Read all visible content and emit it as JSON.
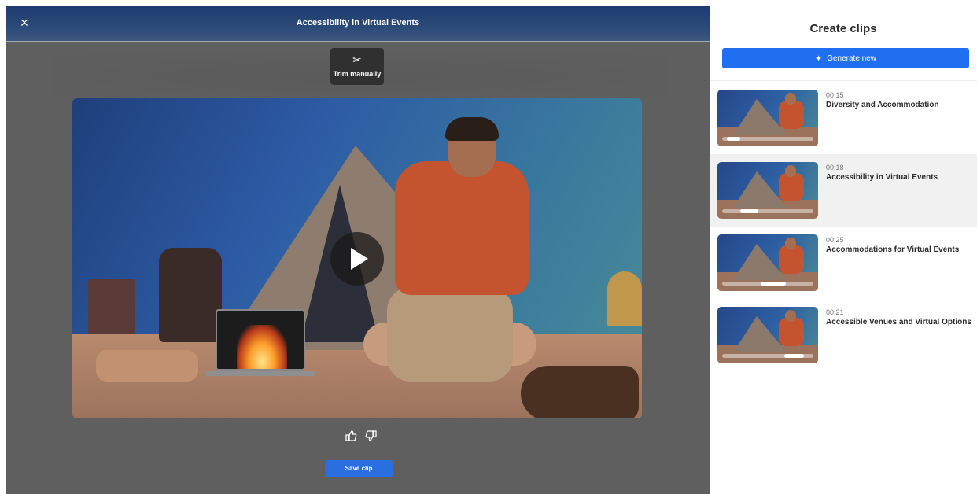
{
  "editor": {
    "title": "Accessibility in Virtual Events",
    "close_label": "×",
    "trim_label": "Trim manually",
    "save_label": "Save clip"
  },
  "panel": {
    "title": "Create clips",
    "generate_label": "Generate new",
    "clips": [
      {
        "duration": "00:15",
        "title": "Diversity and Accommodation",
        "selected": false,
        "progress_start": 0.05,
        "progress_end": 0.2
      },
      {
        "duration": "00:18",
        "title": "Accessibility in Virtual Events",
        "selected": true,
        "progress_start": 0.2,
        "progress_end": 0.4
      },
      {
        "duration": "00:25",
        "title": "Accommodations for Virtual Events",
        "selected": false,
        "progress_start": 0.42,
        "progress_end": 0.7
      },
      {
        "duration": "00:21",
        "title": "Accessible Venues and Virtual Options",
        "selected": false,
        "progress_start": 0.68,
        "progress_end": 0.9
      }
    ]
  },
  "icons": {
    "close": "close-icon",
    "scissors": "scissors-icon",
    "play": "play-icon",
    "thumb_up": "thumbs-up-icon",
    "thumb_down": "thumbs-down-icon",
    "sparkle": "sparkle-icon"
  },
  "colors": {
    "accent": "#1f6ff0",
    "selected_bg": "#f1f1f1",
    "editor_bg": "#5f5f5f",
    "header_bg": "#1e3c70"
  }
}
